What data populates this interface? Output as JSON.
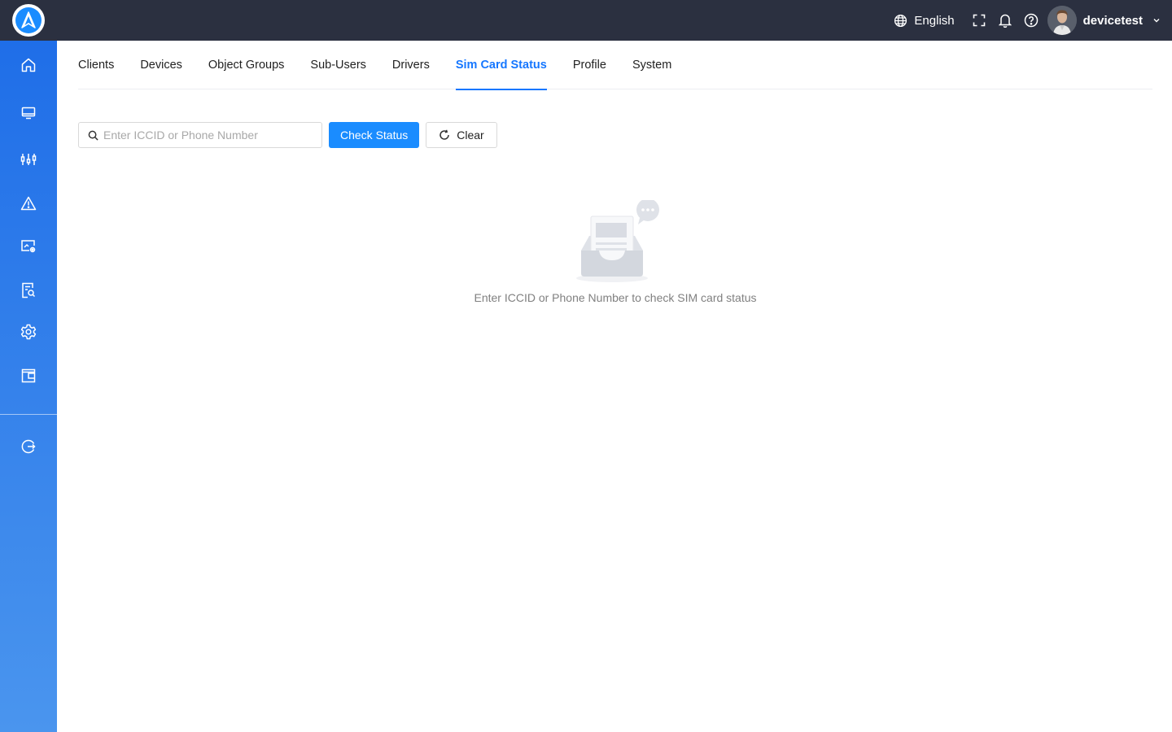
{
  "header": {
    "language": "English",
    "username": "devicetest"
  },
  "tabs": [
    {
      "label": "Clients"
    },
    {
      "label": "Devices"
    },
    {
      "label": "Object Groups"
    },
    {
      "label": "Sub-Users"
    },
    {
      "label": "Drivers"
    },
    {
      "label": "Sim Card Status",
      "active": true
    },
    {
      "label": "Profile"
    },
    {
      "label": "System"
    }
  ],
  "search": {
    "placeholder": "Enter ICCID or Phone Number",
    "value": ""
  },
  "buttons": {
    "check_status": "Check Status",
    "clear": "Clear"
  },
  "empty_state": {
    "message": "Enter ICCID or Phone Number to check SIM card status"
  },
  "sidebar_icons": [
    "home-icon",
    "monitor-icon",
    "equalizer-icon",
    "warning-icon",
    "screen-settings-icon",
    "report-search-icon",
    "gear-icon",
    "wallet-icon",
    "logout-icon"
  ],
  "colors": {
    "topbar": "#2b3040",
    "accent": "#1677ff",
    "sidebar_top": "#1f6ee8",
    "sidebar_bottom": "#4a95ee"
  }
}
